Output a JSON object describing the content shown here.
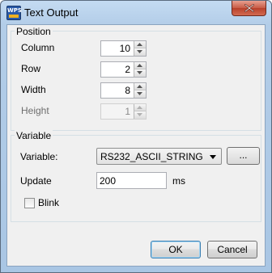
{
  "window": {
    "title": "Text Output",
    "app_icon_text": "WPS"
  },
  "position": {
    "legend": "Position",
    "column": {
      "label": "Column",
      "value": "10"
    },
    "row": {
      "label": "Row",
      "value": "2"
    },
    "width": {
      "label": "Width",
      "value": "8"
    },
    "height": {
      "label": "Height",
      "value": "1"
    }
  },
  "variable": {
    "legend": "Variable",
    "variable_label": "Variable:",
    "variable_value": "RS232_ASCII_STRING",
    "browse_label": "...",
    "update_label": "Update",
    "update_value": "200",
    "update_unit": "ms",
    "blink_label": "Blink",
    "blink_checked": false
  },
  "buttons": {
    "ok": "OK",
    "cancel": "Cancel"
  },
  "colors": {
    "title_bar": "#b3cde8",
    "close_button": "#c75a45",
    "dialog_bg": "#f0f0f0"
  }
}
